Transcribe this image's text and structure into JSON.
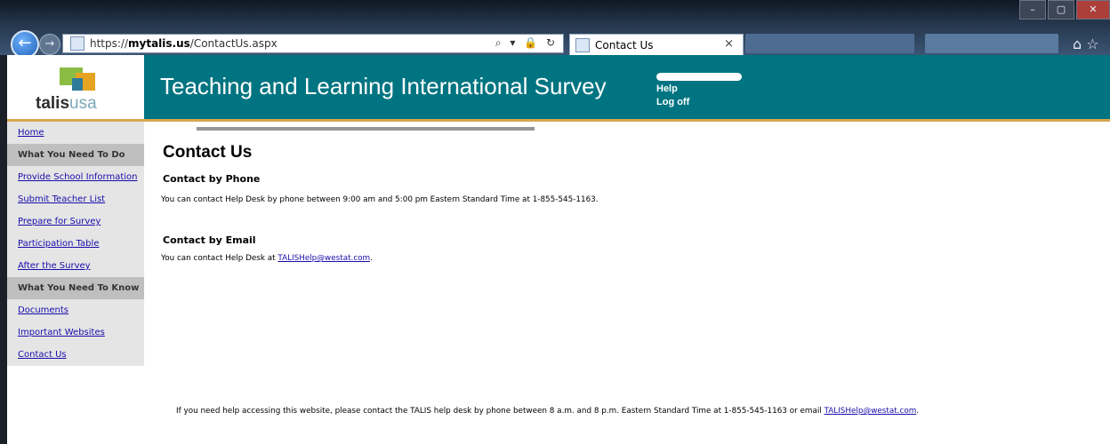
{
  "browser": {
    "url_prefix": "https://",
    "url_host": "mytalis.us",
    "url_path": "/ContactUs.aspx",
    "address_icons": "⌕ ▾ 🔒 ↻",
    "tab_title": "Contact Us",
    "tab_close": "×",
    "window_buttons": [
      "–",
      "▢",
      "✕"
    ],
    "back": "←",
    "forward": "→",
    "right_icons": "⌂ ☆"
  },
  "site": {
    "logo_text_bold": "talis",
    "logo_text_light": "usa",
    "title": "Teaching and Learning International Survey",
    "links": [
      "Help",
      "Log off"
    ]
  },
  "sidebar": {
    "items": [
      {
        "type": "link",
        "label": "Home"
      },
      {
        "type": "header",
        "label": "What You Need To Do"
      },
      {
        "type": "link",
        "label": "Provide School Information"
      },
      {
        "type": "link",
        "label": "Submit Teacher List"
      },
      {
        "type": "link",
        "label": "Prepare for Survey"
      },
      {
        "type": "link",
        "label": "Participation Table"
      },
      {
        "type": "link",
        "label": "After the Survey"
      },
      {
        "type": "header",
        "label": "What You Need To Know"
      },
      {
        "type": "link",
        "label": "Documents"
      },
      {
        "type": "link",
        "label": "Important Websites"
      },
      {
        "type": "link",
        "label": "Contact Us"
      }
    ]
  },
  "main": {
    "title": "Contact Us",
    "phone_heading": "Contact by Phone",
    "phone_text": "You can contact Help Desk by phone between 9:00 am and 5:00 pm Eastern Standard Time at 1-855-545-1163.",
    "email_heading": "Contact by Email",
    "email_text": "You can contact Help Desk at ",
    "email_link": "TALISHelp@westat.com",
    "email_suffix": "."
  },
  "footer": {
    "text": "If you need help accessing this website, please contact the TALIS help desk by phone between 8 a.m. and 8 p.m. Eastern Standard Time at 1-855-545-1163 or email ",
    "email_link": "TALISHelp@westat.com",
    "suffix": "."
  }
}
